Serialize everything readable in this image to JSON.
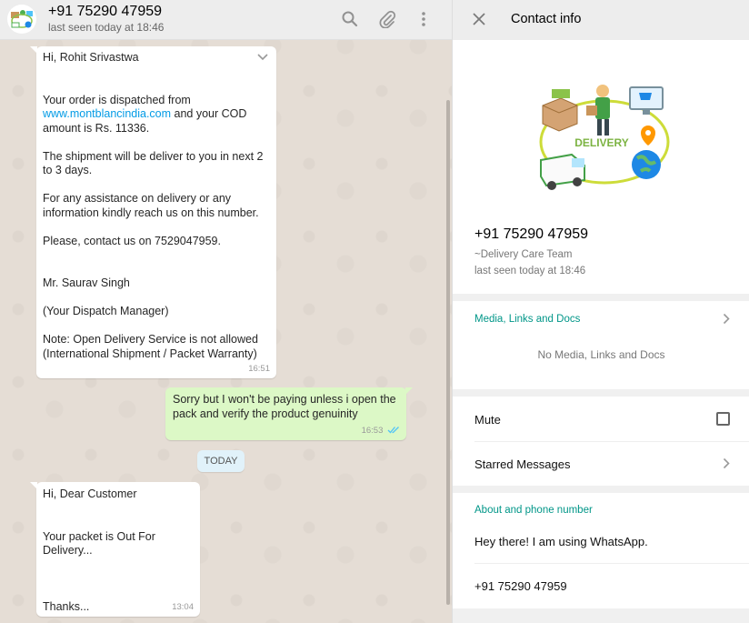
{
  "chat_header": {
    "name": "+91 75290 47959",
    "status": "last seen today at 18:46",
    "icons": [
      "search-icon",
      "attach-icon",
      "menu-icon"
    ]
  },
  "messages": [
    {
      "direction": "incoming",
      "lines_before_link": "Hi, Rohit Srivastwa\n\n\nYour order is dispatched from",
      "link": "www.montblancindia.com",
      "after_link": " and your COD amount is Rs. 11336.\n\nThe shipment will be deliver to you in next 2 to 3 days.\n\nFor any assistance on delivery or any information kindly reach us on this number.\n\nPlease, contact us on 7529047959.\n\n\nMr. Saurav Singh\n\n(Your Dispatch Manager)\n\nNote: Open Delivery Service is not allowed (International Shipment / Packet Warranty)",
      "time": "16:51"
    },
    {
      "direction": "outgoing",
      "text": "Sorry but I won't be paying unless i open the pack and verify the product genuinity",
      "time": "16:53"
    },
    {
      "direction": "incoming",
      "text": "Hi, Dear Customer\n\n\nYour packet is Out For Delivery...\n\n\n\nThanks...",
      "time": "13:04"
    }
  ],
  "day_badge": "TODAY",
  "contact_info": {
    "title": "Contact info",
    "image_text": "DELIVERY",
    "name": "+91 75290 47959",
    "about_short": "~Delivery Care Team",
    "last_seen": "last seen today at 18:46",
    "media_label": "Media, Links and Docs",
    "media_empty": "No Media, Links and Docs",
    "mute_label": "Mute",
    "starred_label": "Starred Messages",
    "about_phone_label": "About and phone number",
    "about_text": "Hey there! I am using WhatsApp.",
    "phone": "+91 75290 47959"
  },
  "colors": {
    "accent": "#009688",
    "outgoing_bubble": "#dcf8c6",
    "chat_bg": "#e5ddd5",
    "link": "#039be5"
  }
}
